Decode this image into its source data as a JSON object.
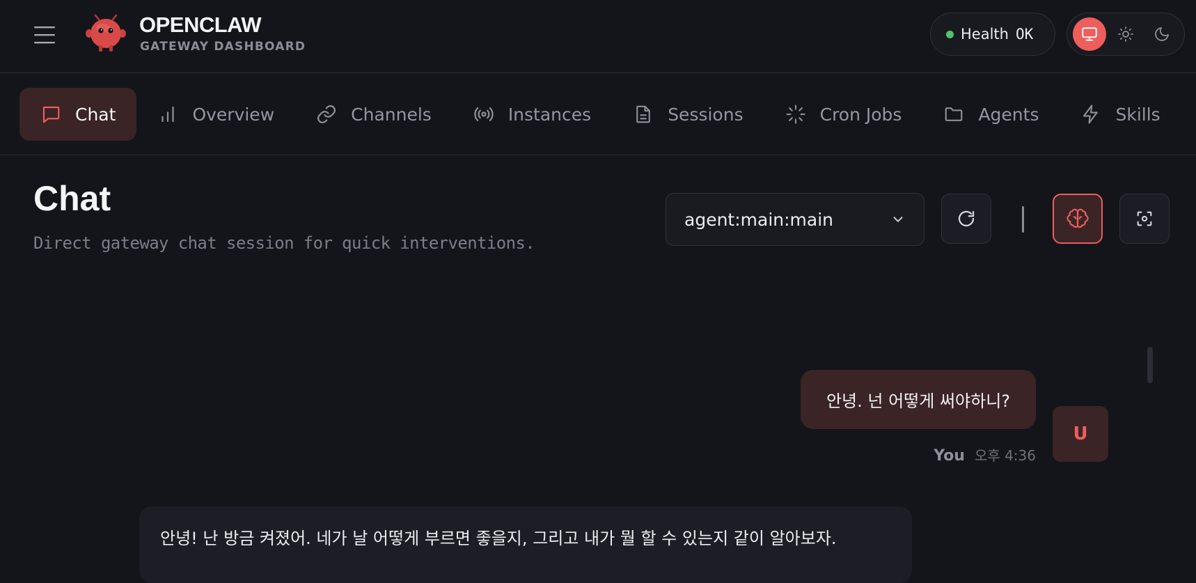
{
  "brand": {
    "title": "OPENCLAW",
    "subtitle": "GATEWAY DASHBOARD"
  },
  "health": {
    "label": "Health",
    "value": "OK",
    "status_color": "#4ec36b"
  },
  "theme": {
    "options": [
      "system",
      "light",
      "dark"
    ],
    "selected": "system",
    "accent": "#ee5e5c"
  },
  "nav": {
    "tabs": [
      {
        "label": "Chat",
        "icon": "chat-bubble-icon",
        "active": true
      },
      {
        "label": "Overview",
        "icon": "bar-chart-icon",
        "active": false
      },
      {
        "label": "Channels",
        "icon": "link-icon",
        "active": false
      },
      {
        "label": "Instances",
        "icon": "broadcast-icon",
        "active": false
      },
      {
        "label": "Sessions",
        "icon": "document-icon",
        "active": false
      },
      {
        "label": "Cron Jobs",
        "icon": "loader-icon",
        "active": false
      },
      {
        "label": "Agents",
        "icon": "folder-icon",
        "active": false
      },
      {
        "label": "Skills",
        "icon": "lightning-icon",
        "active": false
      }
    ]
  },
  "page": {
    "title": "Chat",
    "subtitle": "Direct gateway chat session for quick interventions."
  },
  "session": {
    "selected": "agent:main:main"
  },
  "toolbar": {
    "refresh_icon": "refresh-icon",
    "thinking_icon": "brain-icon",
    "focus_icon": "focus-icon",
    "thinking_active": true
  },
  "messages": [
    {
      "role": "user",
      "text": "안녕. 넌 어떻게 써야하니?",
      "sender": "You",
      "time": "오후 4:36",
      "avatar": "U"
    },
    {
      "role": "assistant",
      "text": "안녕! 난 방금 켜졌어. 네가 날 어떻게 부르면 좋을지, 그리고 내가 뭘 할 수 있는지 같이 알아보자."
    }
  ]
}
